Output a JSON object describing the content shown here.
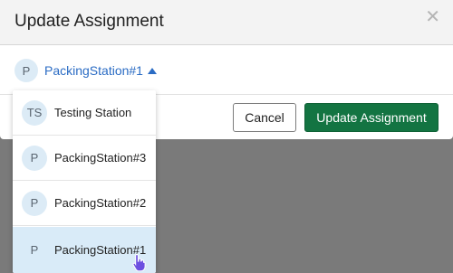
{
  "dialog": {
    "title": "Update Assignment",
    "close_icon": "close-icon"
  },
  "selector": {
    "avatar": "P",
    "value": "PackingStation#1",
    "state": "expanded"
  },
  "dropdown": {
    "items": [
      {
        "avatar": "TS",
        "label": "Testing Station",
        "selected": false
      },
      {
        "avatar": "P",
        "label": "PackingStation#3",
        "selected": false
      },
      {
        "avatar": "P",
        "label": "PackingStation#2",
        "selected": false
      },
      {
        "avatar": "P",
        "label": "PackingStation#1",
        "selected": true
      }
    ]
  },
  "footer": {
    "cancel_label": "Cancel",
    "update_label": "Update Assignment"
  },
  "colors": {
    "primary_button": "#137442",
    "link": "#2b6cc4",
    "avatar_bg": "#dcebf6",
    "selected_bg": "#d9ebf8",
    "overlay": "#7a7a7a"
  },
  "cursor": "hand-pointer-icon"
}
